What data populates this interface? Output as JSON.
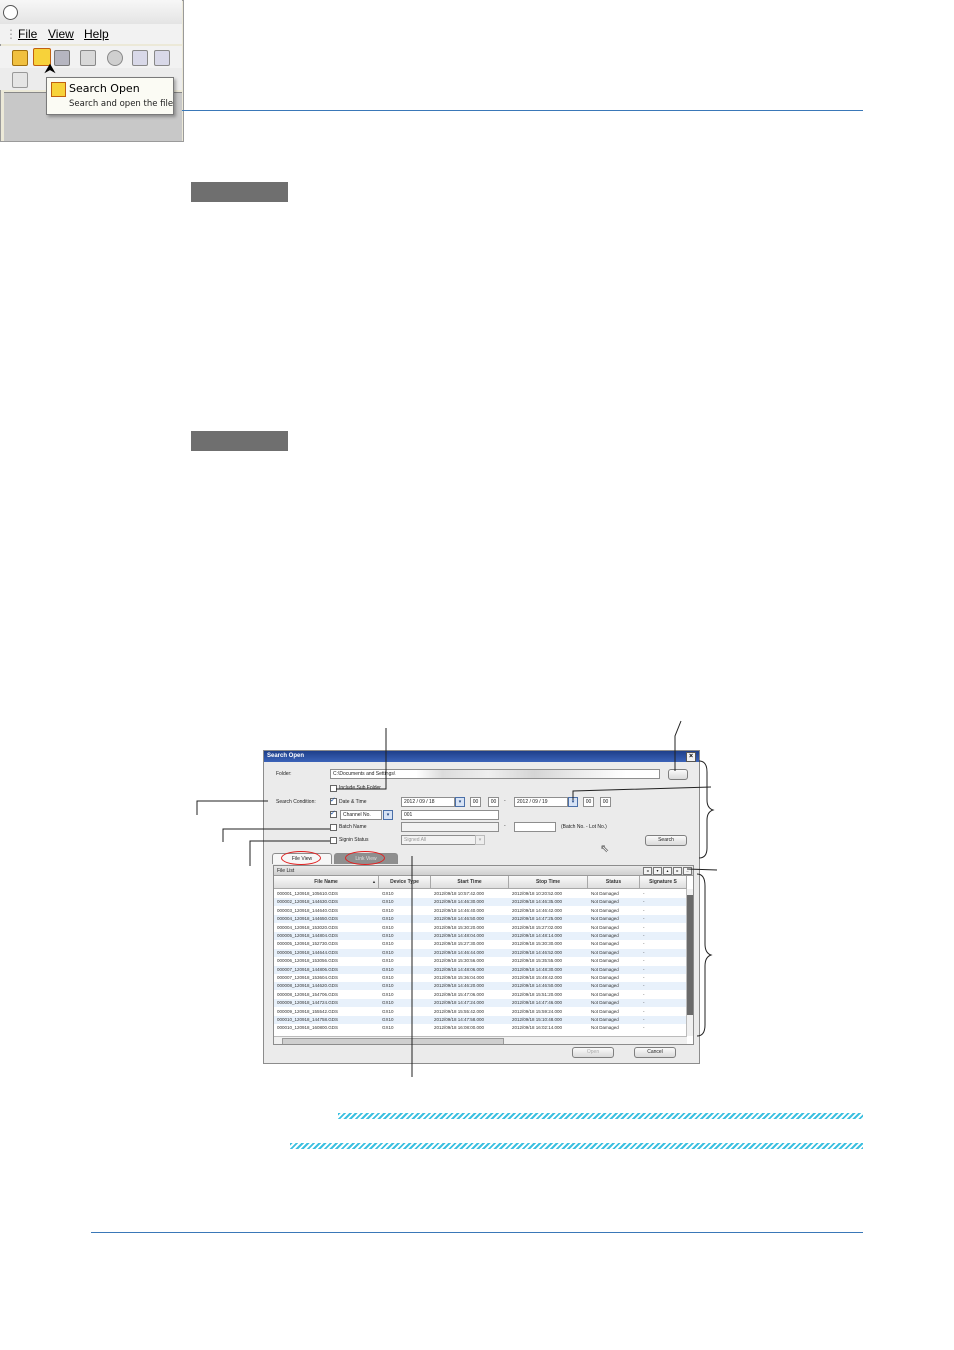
{
  "screenshot1": {
    "menu": [
      "File",
      "View",
      "Help"
    ],
    "tooltip_title": "Search Open",
    "tooltip_desc": "Search and open the file"
  },
  "dialog": {
    "title": "Search Open",
    "close_glyph": "×",
    "folder_label": "Folder:",
    "folder_value": "C:\\Documents and Settings\\",
    "include_sub_folder": "Include Sub Folder",
    "search_condition_label": "Search Condition:",
    "date_time_label": "Date & Time",
    "date_sep": "-",
    "from_date": "2012  /  09  /  18",
    "from_hour": "00",
    "from_min": "00",
    "to_date": "2012  /  09  /  19",
    "to_hour": "00",
    "to_min": "00",
    "channel_select": "Channel No.",
    "channel_value": "001",
    "batch_name_label": "Batch Name",
    "batch_sep": "-",
    "batch_hint": "(Batch No. - Lot No.)",
    "signin_status_label": "Signin Status",
    "signin_select": "Signed All",
    "search_button": "Search",
    "tab_file_view": "File View",
    "tab_link_view": "Link View",
    "file_list_label": "File List",
    "columns": [
      "File Name",
      "Device Type",
      "Start Time",
      "Stop Time",
      "Status",
      "Signature S"
    ],
    "rows": [
      [
        "000001_120918_105610.GDS",
        "GX10",
        "2012/09/18 10:57:42.000",
        "2012/09/18 10:20:52.000",
        "Not Damaged",
        "-"
      ],
      [
        "000002_120918_144630.GDS",
        "GX10",
        "2012/09/18 14:46:30.000",
        "2012/09/18 14:46:35.000",
        "Not Damaged",
        "-"
      ],
      [
        "000003_120918_144640.GDS",
        "GX10",
        "2012/09/18 14:46:40.000",
        "2012/09/18 14:46:42.000",
        "Not Damaged",
        "-"
      ],
      [
        "000004_120918_144650.GDS",
        "GX10",
        "2012/09/18 14:46:50.000",
        "2012/09/18 14:47:25.000",
        "Not Damaged",
        "-"
      ],
      [
        "000004_120918_153020.GDS",
        "GX10",
        "2012/09/18 15:30:20.000",
        "2012/09/18 15:27:02.000",
        "Not Damaged",
        "-"
      ],
      [
        "000005_120918_144804.GDS",
        "GX10",
        "2012/09/18 14:48:04.000",
        "2012/09/18 14:48:14.000",
        "Not Damaged",
        "-"
      ],
      [
        "000005_120918_152730.GDS",
        "GX10",
        "2012/09/18 15:27:30.000",
        "2012/09/18 15:30:30.000",
        "Not Damaged",
        "-"
      ],
      [
        "000006_120918_144644.GDS",
        "GX10",
        "2012/09/18 14:46:44.000",
        "2012/09/18 14:46:52.000",
        "Not Damaged",
        "-"
      ],
      [
        "000006_120918_153056.GDS",
        "GX10",
        "2012/09/18 15:30:56.000",
        "2012/09/18 15:35:55.000",
        "Not Damaged",
        "-"
      ],
      [
        "000007_120918_144806.GDS",
        "GX10",
        "2012/09/18 14:48:06.000",
        "2012/09/18 14:48:30.000",
        "Not Damaged",
        "-"
      ],
      [
        "000007_120918_153604.GDS",
        "GX10",
        "2012/09/18 15:36:04.000",
        "2012/09/18 15:49:42.000",
        "Not Damaged",
        "-"
      ],
      [
        "000008_120918_144620.GDS",
        "GX10",
        "2012/09/18 14:46:20.000",
        "2012/09/18 14:46:50.000",
        "Not Damaged",
        "-"
      ],
      [
        "000008_120918_154706.GDS",
        "GX10",
        "2012/09/18 15:47:06.000",
        "2012/09/18 15:51:20.000",
        "Not Damaged",
        "-"
      ],
      [
        "000009_120918_144724.GDS",
        "GX10",
        "2012/09/18 14:47:24.000",
        "2012/09/18 14:47:46.000",
        "Not Damaged",
        "-"
      ],
      [
        "000009_120918_155542.GDS",
        "GX10",
        "2012/09/18 15:55:42.000",
        "2012/09/18 15:59:24.000",
        "Not Damaged",
        "-"
      ],
      [
        "000010_120918_144758.GDS",
        "GX10",
        "2012/09/18 14:47:58.000",
        "2012/09/18 15:10:48.000",
        "Not Damaged",
        "-"
      ],
      [
        "000010_120918_160800.GDS",
        "GX10",
        "2012/09/18 16:08:00.000",
        "2012/09/18 16:02:14.000",
        "Not Damaged",
        "-"
      ]
    ],
    "open_button": "Open",
    "cancel_button": "Cancel"
  }
}
